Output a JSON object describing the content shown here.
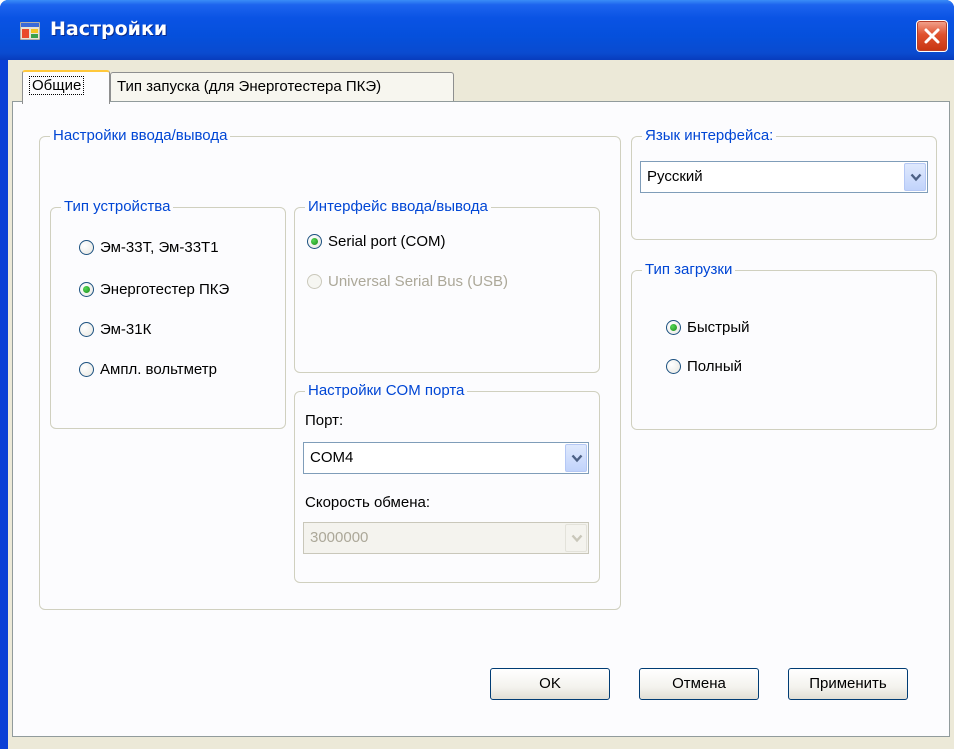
{
  "window": {
    "title": "Настройки"
  },
  "tabs": [
    {
      "label": "Общие",
      "active": true
    },
    {
      "label": "Тип запуска (для Энерготестера ПКЭ)",
      "active": false
    }
  ],
  "io_settings": {
    "legend": "Настройки ввода/вывода",
    "device_type": {
      "legend": "Тип устройства",
      "options": [
        {
          "label": "Эм-33Т, Эм-33Т1",
          "checked": false
        },
        {
          "label": "Энерготестер ПКЭ",
          "checked": true
        },
        {
          "label": "Эм-31К",
          "checked": false
        },
        {
          "label": "Ампл. вольтметр",
          "checked": false
        }
      ]
    },
    "io_interface": {
      "legend": "Интерфейс ввода/вывода",
      "options": [
        {
          "label": "Serial port (COM)",
          "checked": true,
          "disabled": false
        },
        {
          "label": "Universal Serial Bus (USB)",
          "checked": false,
          "disabled": true
        }
      ]
    },
    "com_settings": {
      "legend": "Настройки COM порта",
      "port_label": "Порт:",
      "port_value": "COM4",
      "speed_label": "Скорость обмена:",
      "speed_value": "3000000"
    }
  },
  "language": {
    "legend": "Язык интерфейса:",
    "value": "Русский"
  },
  "load_type": {
    "legend": "Тип загрузки",
    "options": [
      {
        "label": "Быстрый",
        "checked": true
      },
      {
        "label": "Полный",
        "checked": false
      }
    ]
  },
  "buttons": {
    "ok": "OK",
    "cancel": "Отмена",
    "apply": "Применить"
  },
  "colors": {
    "titlebar": "#0550dc",
    "group_legend": "#0046d5",
    "client": "#ece9d8",
    "radio_dot": "#21a121",
    "close": "#e0522e"
  }
}
